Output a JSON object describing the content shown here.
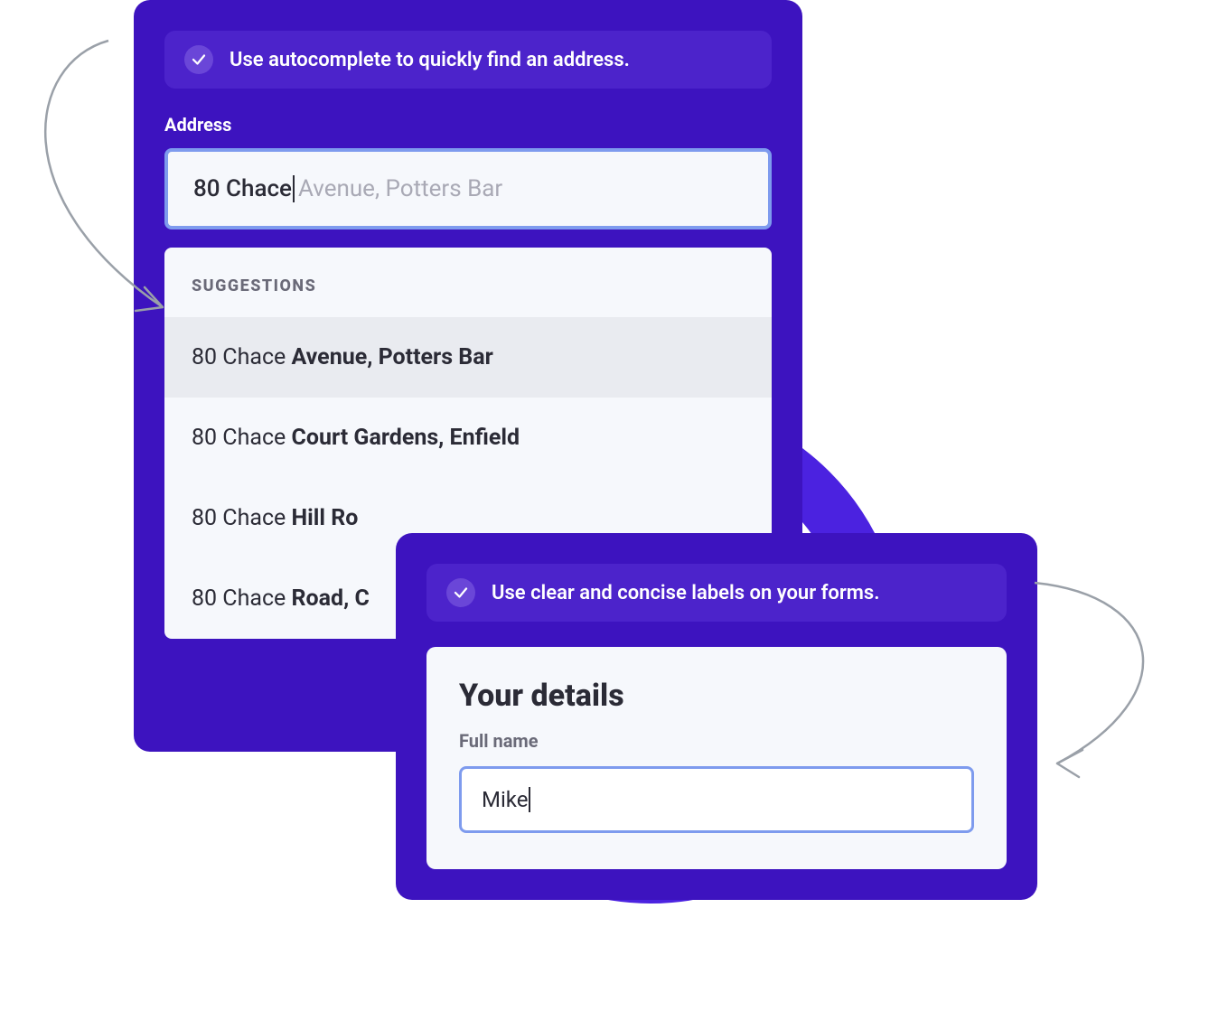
{
  "panel_a": {
    "tip": "Use autocomplete to quickly find an address.",
    "address_label": "Address",
    "input_typed": "80 Chace",
    "input_ghost": " Avenue, Potters Bar",
    "suggestions_header": "SUGGESTIONS",
    "suggestions": [
      {
        "prefix": "80 Chace ",
        "rest": "Avenue, Potters Bar",
        "selected": true
      },
      {
        "prefix": "80 Chace ",
        "rest": "Court Gardens, Enfield",
        "selected": false
      },
      {
        "prefix": "80 Chace ",
        "rest": "Hill Ro",
        "selected": false
      },
      {
        "prefix": "80 Chace ",
        "rest": "Road, C",
        "selected": false
      }
    ]
  },
  "panel_b": {
    "tip": "Use clear and concise labels on your forms.",
    "title": "Your details",
    "name_label": "Full name",
    "name_value": "Mike"
  }
}
